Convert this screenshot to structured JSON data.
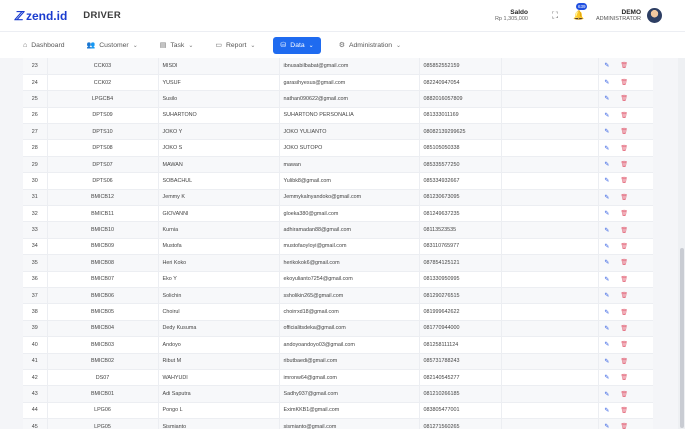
{
  "header": {
    "logo_mark": "ℤ",
    "logo_text": "zend.id",
    "title": "DRIVER",
    "saldo_label": "Saldo",
    "saldo_value": "Rp 1,305,000",
    "fullscreen_icon": "⛶",
    "notif_icon": "🔔",
    "notif_count": "639",
    "user_name": "DEMO",
    "user_role": "ADMINISTRATOR"
  },
  "nav": {
    "items": [
      {
        "label": "Dashboard",
        "icon": "⌂"
      },
      {
        "label": "Customer",
        "icon": "👥"
      },
      {
        "label": "Task",
        "icon": "▤"
      },
      {
        "label": "Report",
        "icon": "▭"
      },
      {
        "label": "Data",
        "icon": "⛁"
      },
      {
        "label": "Administration",
        "icon": "⚙"
      }
    ],
    "chevron": "⌄"
  },
  "table": {
    "edit_icon": "✎",
    "delete_icon": "🗑",
    "rows": [
      [
        "23",
        "CCK03",
        "MISDI",
        "ibnusabilbabat@gmail.com",
        "085852552159"
      ],
      [
        "24",
        "CCK02",
        "YUSUF",
        "garasihyesus@gmail.com",
        "082240947054"
      ],
      [
        "25",
        "LPGCB4",
        "Susilo",
        "nathan090622@gmail.com",
        "0882016057809"
      ],
      [
        "26",
        "DPTS09",
        "SUHARTONO",
        "SUHARTONO PERSONALIA",
        "081333011169"
      ],
      [
        "27",
        "DPTS10",
        "JOKO Y",
        "JOKO YULIANTO",
        "08082139299625"
      ],
      [
        "28",
        "DPTS08",
        "JOKO S",
        "JOKO SUTOPO",
        "085105050338"
      ],
      [
        "29",
        "DPTS07",
        "MAWAN",
        "mawan",
        "085335577250"
      ],
      [
        "30",
        "DPTS06",
        "SOBACHUL",
        "Yulibk8@gmail.com",
        "085334932667"
      ],
      [
        "31",
        "BMICB12",
        "Jemmy K",
        "Jemmykalnyandoko@gmail.com",
        "081230673095"
      ],
      [
        "32",
        "BMICB11",
        "GIOVANNI",
        "gloeka380@gmail.com",
        "081249637235"
      ],
      [
        "33",
        "BMICB10",
        "Kurnia",
        "adhiramadan88@gmail.com",
        "08113523535"
      ],
      [
        "34",
        "BMICB09",
        "Mustofa",
        "mustofaoyloyi@gmail.com",
        "083110765977"
      ],
      [
        "35",
        "BMICB08",
        "Heri Koko",
        "herikokok6@gmail.com",
        "087854125121"
      ],
      [
        "36",
        "BMICB07",
        "Eko Y",
        "ekoyulianto7254@gmail.com",
        "081330950995"
      ],
      [
        "37",
        "BMICB06",
        "Solichin",
        "ssholikin265@gmail.com",
        "081290276515"
      ],
      [
        "38",
        "BMICB05",
        "Choirul",
        "choirrxd18@gmail.com",
        "081999642622"
      ],
      [
        "39",
        "BMICB04",
        "Dedy Kusuma",
        "officialitsdeka@gmail.com",
        "081770944000"
      ],
      [
        "40",
        "BMICB03",
        "Andoyo",
        "andoyoandoyo03@gmail.com",
        "081258111124"
      ],
      [
        "41",
        "BMICB02",
        "Ribut M",
        "ributbaedi@gmail.com",
        "085731788243"
      ],
      [
        "42",
        "DS07",
        "WAHYUDI",
        "imronw64@gmail.com",
        "082140545277"
      ],
      [
        "43",
        "BMICB01",
        "Adi Saputra",
        "Sadhy937@gmail.com",
        "081210266185"
      ],
      [
        "44",
        "LPG06",
        "Pongo L",
        "EximKKB1@gmail.com",
        "083805477001"
      ],
      [
        "45",
        "LPG05",
        "Sismianto",
        "sismianto@gmail.com",
        "081271560265"
      ]
    ]
  }
}
